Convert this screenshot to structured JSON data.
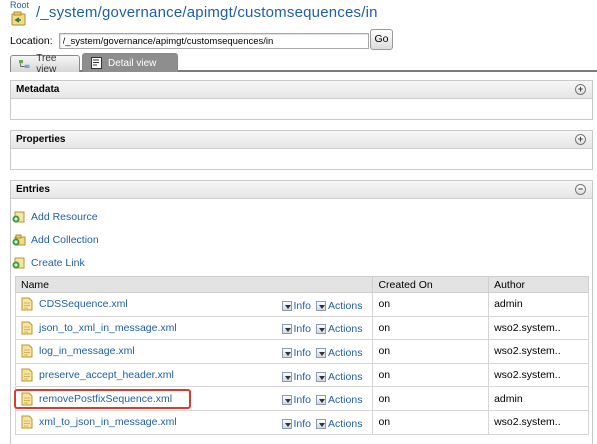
{
  "header": {
    "root_label": "Root",
    "path_title": "/_system/governance/apimgt/customsequences/in"
  },
  "location": {
    "label": "Location:",
    "value": "/_system/governance/apimgt/customsequences/in",
    "go_label": "Go"
  },
  "tabs": [
    {
      "label": "Tree view",
      "icon": "tree-icon",
      "active": false
    },
    {
      "label": "Detail view",
      "icon": "document-icon",
      "active": true
    }
  ],
  "panels": {
    "metadata": {
      "title": "Metadata",
      "toggle": "+"
    },
    "properties": {
      "title": "Properties",
      "toggle": "+"
    },
    "entries": {
      "title": "Entries",
      "toggle": "−"
    }
  },
  "entry_actions": [
    {
      "label": "Add Resource",
      "icon": "add-resource-icon"
    },
    {
      "label": "Add Collection",
      "icon": "add-collection-icon"
    },
    {
      "label": "Create Link",
      "icon": "create-link-icon"
    }
  ],
  "table": {
    "columns": [
      "Name",
      "",
      "Created On",
      "Author"
    ],
    "info_label": "Info",
    "actions_label": "Actions",
    "rows": [
      {
        "name": "CDSSequence.xml",
        "created": "on",
        "author": "admin"
      },
      {
        "name": "json_to_xml_in_message.xml",
        "created": "on",
        "author": "wso2.system.."
      },
      {
        "name": "log_in_message.xml",
        "created": "on",
        "author": "wso2.system.."
      },
      {
        "name": "preserve_accept_header.xml",
        "created": "on",
        "author": "wso2.system.."
      },
      {
        "name": "removePostfixSequence.xml",
        "created": "on",
        "author": "admin",
        "highlighted": true
      },
      {
        "name": "xml_to_json_in_message.xml",
        "created": "on",
        "author": "wso2.system.."
      }
    ]
  },
  "colors": {
    "link": "#1f5fa8",
    "highlight": "#e0392b",
    "active_tab": "#8e8e8e"
  }
}
